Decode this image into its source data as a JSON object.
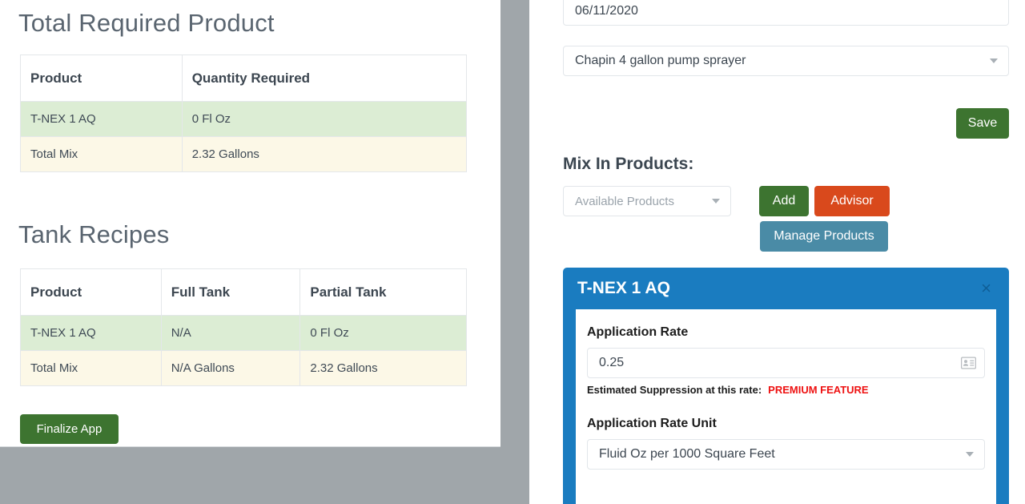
{
  "left": {
    "total_required_title": "Total Required Product",
    "total_required_table": {
      "headers": [
        "Product",
        "Quantity Required"
      ],
      "rows": [
        {
          "product": "T-NEX 1 AQ",
          "quantity": "0 Fl Oz"
        },
        {
          "product": "Total Mix",
          "quantity": "2.32 Gallons"
        }
      ]
    },
    "tank_recipes_title": "Tank Recipes",
    "tank_recipes_table": {
      "headers": [
        "Product",
        "Full Tank",
        "Partial Tank"
      ],
      "rows": [
        {
          "product": "T-NEX 1 AQ",
          "full_tank": "N/A",
          "partial_tank": "0 Fl Oz"
        },
        {
          "product": "Total Mix",
          "full_tank": "N/A Gallons",
          "partial_tank": "2.32 Gallons"
        }
      ]
    },
    "finalize_button": "Finalize App"
  },
  "right": {
    "date_value": "06/11/2020",
    "sprayer_value": "Chapin 4 gallon pump sprayer",
    "save_button": "Save",
    "mix_in_products_label": "Mix In Products:",
    "available_products_placeholder": "Available Products",
    "add_button": "Add",
    "advisor_button": "Advisor",
    "manage_products_button": "Manage Products"
  },
  "product_panel": {
    "title": "T-NEX 1 AQ",
    "close_glyph": "×",
    "application_rate_label": "Application Rate",
    "application_rate_value": "0.25",
    "suppression_label": "Estimated Suppression at this rate:",
    "suppression_value": "PREMIUM FEATURE",
    "application_rate_unit_label": "Application Rate Unit",
    "application_rate_unit_value": "Fluid Oz per 1000 Square Feet"
  },
  "colors": {
    "green": "#3d7430",
    "orange": "#d9491c",
    "teal": "#4a8ba6",
    "blue": "#1a7cc0",
    "red": "#ee1111",
    "row_green": "#dcedd4",
    "row_cream": "#fcf8e7",
    "gutter_gray": "#a0a6aa"
  }
}
